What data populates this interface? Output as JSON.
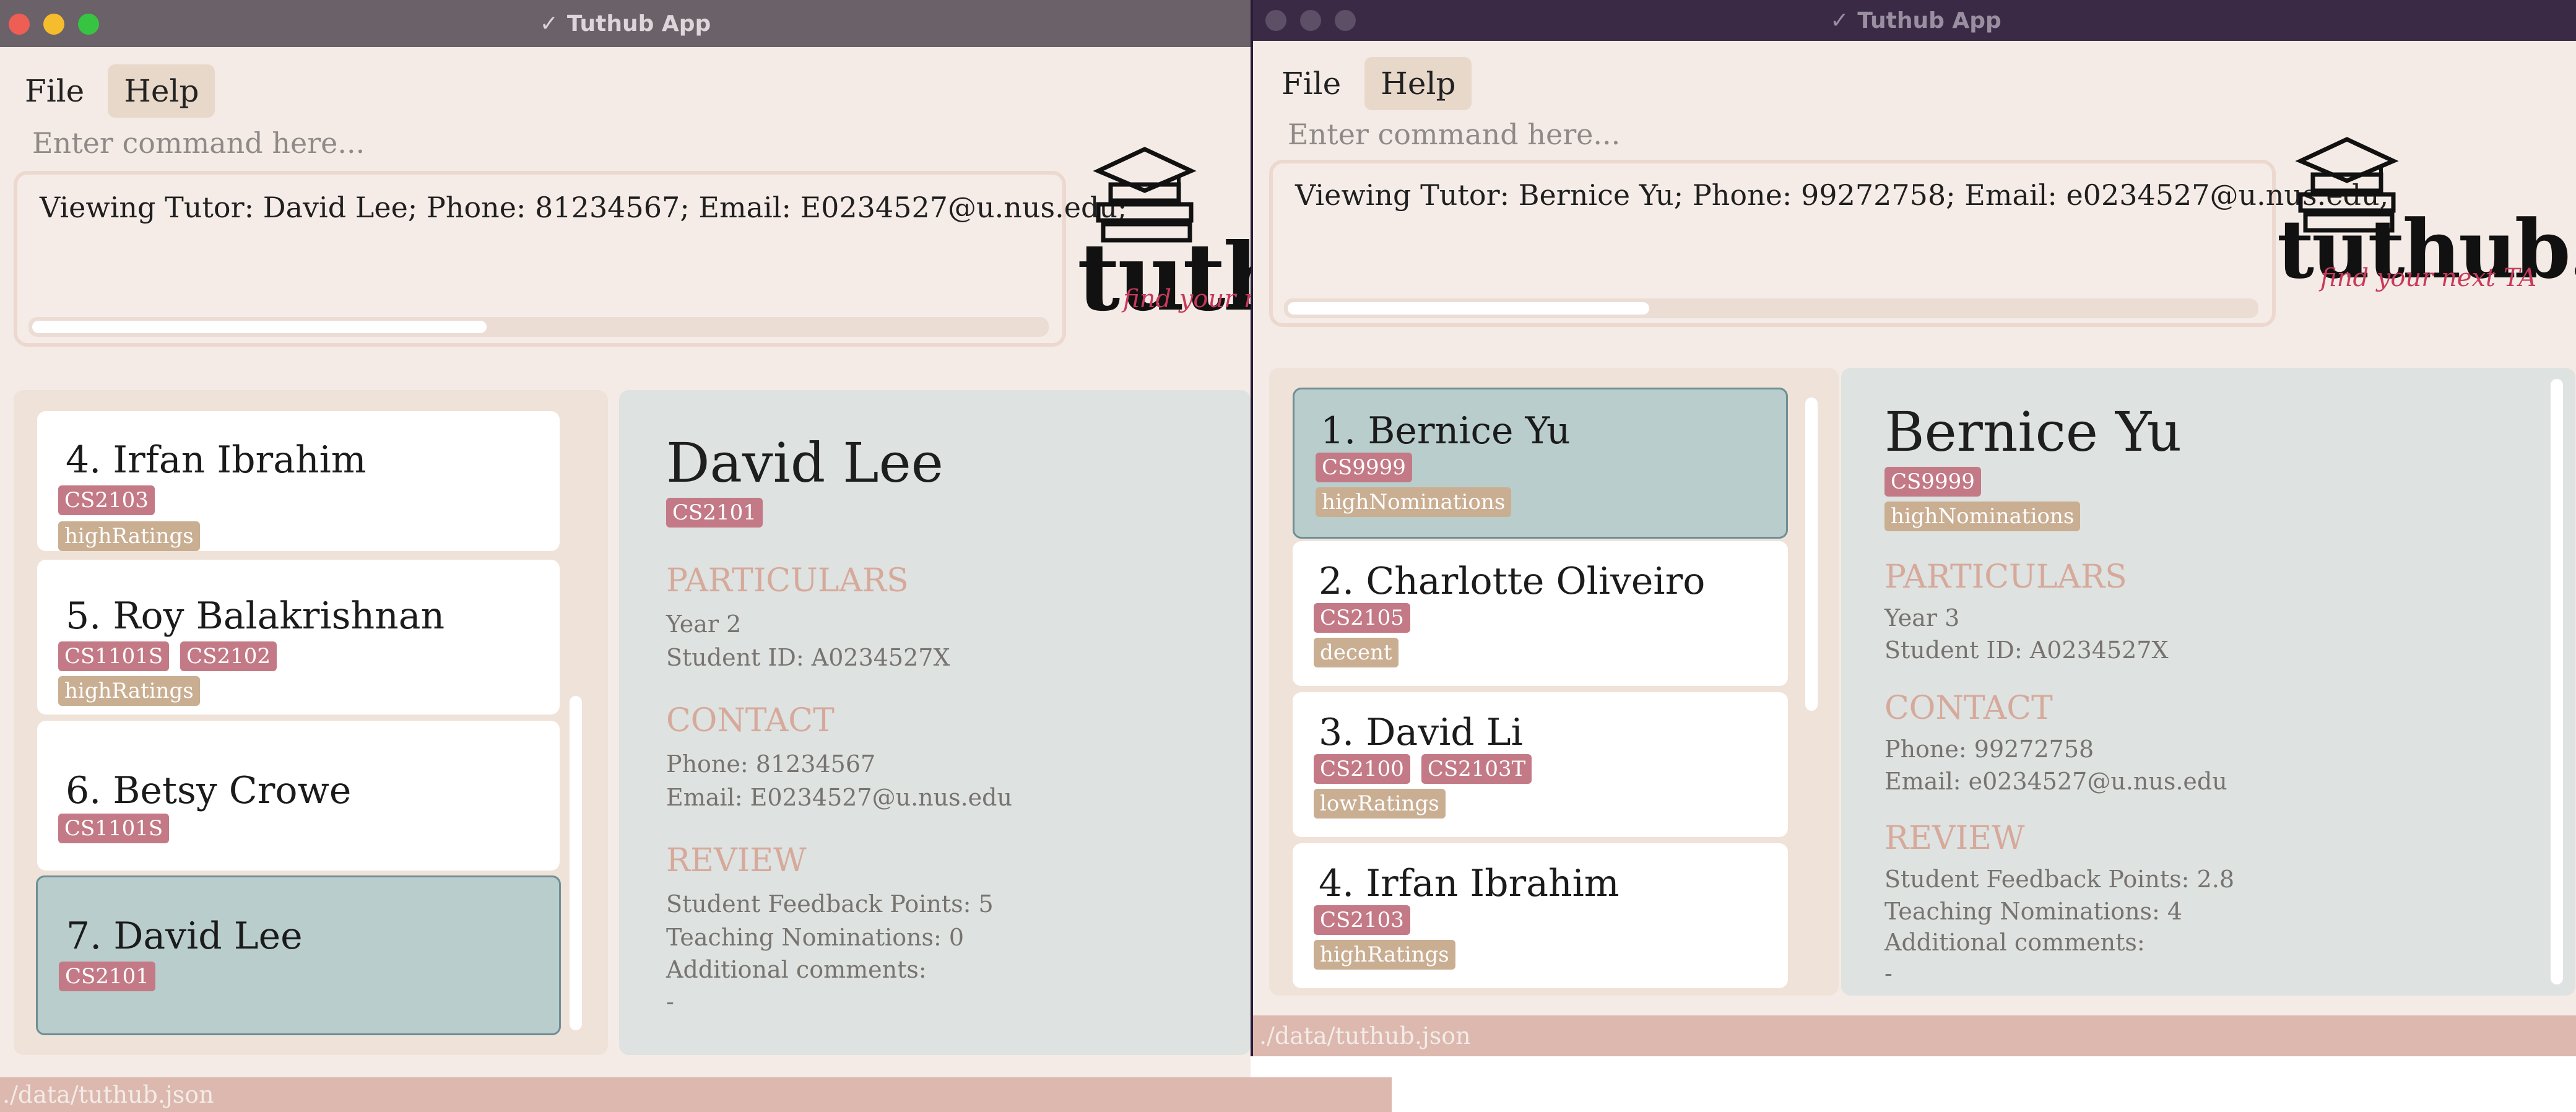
{
  "app_title": "Tuthub App",
  "menu": {
    "file": "File",
    "help": "Help"
  },
  "command_placeholder": "Enter command here...",
  "logo": {
    "word": "tuthub.",
    "tagline": "find your next TA"
  },
  "left": {
    "result": "Viewing Tutor: David Lee; Phone: 81234567; Email: E0234527@u.nus.edu;",
    "list": [
      {
        "index": "4.",
        "name": "Irfan Ibrahim",
        "modules": [
          "CS2103"
        ],
        "ratings": [
          "highRatings"
        ]
      },
      {
        "index": "5.",
        "name": "Roy Balakrishnan",
        "modules": [
          "CS1101S",
          "CS2102"
        ],
        "ratings": [
          "highRatings"
        ]
      },
      {
        "index": "6.",
        "name": "Betsy Crowe",
        "modules": [
          "CS1101S"
        ],
        "ratings": []
      },
      {
        "index": "7.",
        "name": "David Lee",
        "modules": [
          "CS2101"
        ],
        "ratings": []
      }
    ],
    "detail": {
      "name": "David Lee",
      "module": "CS2101",
      "rating": "",
      "particulars_heading": "PARTICULARS",
      "year": "Year 2",
      "student_id": "Student ID: A0234527X",
      "contact_heading": "CONTACT",
      "phone": "Phone: 81234567",
      "email": "Email: E0234527@u.nus.edu",
      "review_heading": "REVIEW",
      "feedback": "Student Feedback Points: 5",
      "nominations": "Teaching Nominations: 0",
      "comments_label": "Additional comments:",
      "comments": "-"
    },
    "status": "./data/tuthub.json"
  },
  "right": {
    "result": "Viewing Tutor: Bernice Yu; Phone: 99272758; Email: e0234527@u.nus.edu;",
    "list": [
      {
        "index": "1.",
        "name": "Bernice Yu",
        "modules": [
          "CS9999"
        ],
        "ratings": [
          "highNominations"
        ]
      },
      {
        "index": "2.",
        "name": "Charlotte Oliveiro",
        "modules": [
          "CS2105"
        ],
        "ratings": [
          "decent"
        ]
      },
      {
        "index": "3.",
        "name": "David Li",
        "modules": [
          "CS2100",
          "CS2103T"
        ],
        "ratings": [
          "lowRatings"
        ]
      },
      {
        "index": "4.",
        "name": "Irfan Ibrahim",
        "modules": [
          "CS2103"
        ],
        "ratings": [
          "highRatings"
        ]
      }
    ],
    "detail": {
      "name": "Bernice Yu",
      "module": "CS9999",
      "rating": "highNominations",
      "particulars_heading": "PARTICULARS",
      "year": "Year 3",
      "student_id": "Student ID: A0234527X",
      "contact_heading": "CONTACT",
      "phone": "Phone: 99272758",
      "email": "Email: e0234527@u.nus.edu",
      "review_heading": "REVIEW",
      "feedback": "Student Feedback Points: 2.8",
      "nominations": "Teaching Nominations: 4",
      "comments_label": "Additional comments:",
      "comments": "-"
    },
    "status": "./data/tuthub.json"
  },
  "colors": {
    "window_bg": "#f4ebe6",
    "module_tag": "#c37a86",
    "rating_tag": "#c9ae92",
    "selected_card": "#b9cdcc",
    "section_heading": "#d6a99a",
    "status_bar": "#dcb8ae"
  }
}
